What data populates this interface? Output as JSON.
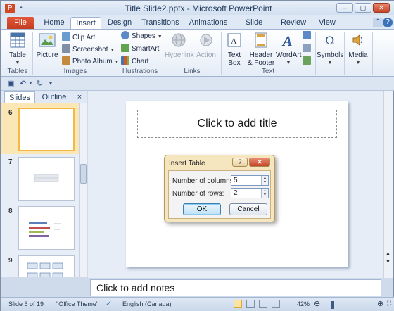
{
  "window": {
    "title": "Title Slide2.pptx - Microsoft PowerPoint",
    "controls": [
      "–",
      "▢",
      "✕"
    ]
  },
  "tabs": [
    "File",
    "Home",
    "Insert",
    "Design",
    "Transitions",
    "Animations",
    "Slide Show",
    "Review",
    "View"
  ],
  "active_tab": "Insert",
  "ribbon": {
    "tables": {
      "label": "Tables",
      "table": "Table"
    },
    "images": {
      "label": "Images",
      "picture": "Picture",
      "clip_art": "Clip Art",
      "screenshot": "Screenshot",
      "photo_album": "Photo Album"
    },
    "illustrations": {
      "label": "Illustrations",
      "shapes": "Shapes",
      "smartart": "SmartArt",
      "chart": "Chart"
    },
    "links": {
      "label": "Links",
      "hyperlink": "Hyperlink",
      "action": "Action"
    },
    "text": {
      "label": "Text",
      "text_box_1": "Text",
      "text_box_2": "Box",
      "header_1": "Header",
      "header_2": "& Footer",
      "wordart": "WordArt"
    },
    "symbols": {
      "label": "Symbols"
    },
    "media": {
      "label": "Media"
    }
  },
  "pane": {
    "tabs": [
      "Slides",
      "Outline"
    ],
    "close": "×",
    "slide_numbers": [
      "6",
      "7",
      "8",
      "9"
    ]
  },
  "slide": {
    "title_placeholder": "Click to add title"
  },
  "dialog": {
    "title": "Insert Table",
    "help": "?",
    "close": "✕",
    "columns_label": "Number of columns:",
    "columns_value": "5",
    "rows_label": "Number of rows:",
    "rows_value": "2",
    "ok": "OK",
    "cancel": "Cancel"
  },
  "notes": {
    "placeholder": "Click to add notes"
  },
  "status": {
    "slide_info": "Slide 6 of 19",
    "theme": "\"Office Theme\"",
    "language": "English (Canada)",
    "zoom": "42%",
    "zoom_level": 0.42
  },
  "colors": {
    "file_tab": "#d24726",
    "selected_thumb_border": "#f4b942",
    "dialog_background": "#f6e6bf"
  }
}
